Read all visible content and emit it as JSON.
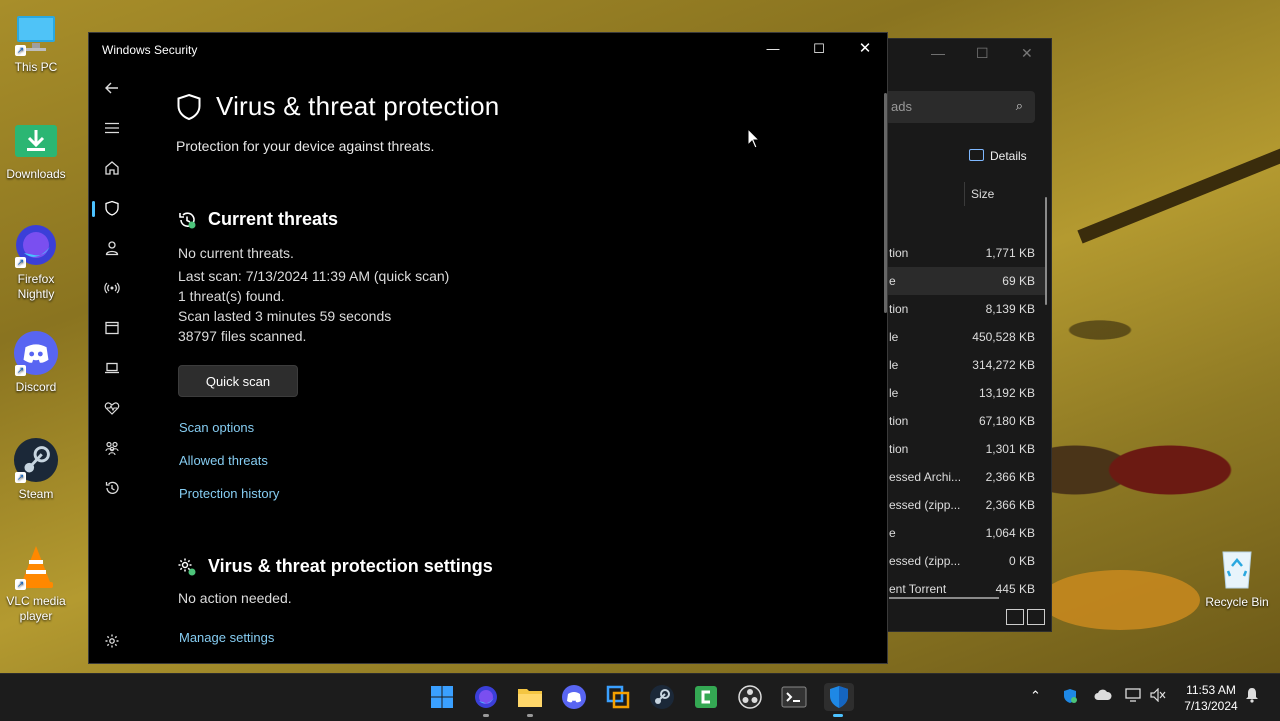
{
  "desktop": {
    "icons": [
      {
        "label": "This PC"
      },
      {
        "label": "Downloads"
      },
      {
        "label": "Firefox Nightly"
      },
      {
        "label": "Discord"
      },
      {
        "label": "Steam"
      },
      {
        "label": "VLC media player"
      },
      {
        "label": "Recycle Bin"
      }
    ]
  },
  "explorer": {
    "search_fragment": "ads",
    "details_label": "Details",
    "size_header": "Size",
    "rows": [
      {
        "type": "tion",
        "size": "1,771 KB"
      },
      {
        "type": "e",
        "size": "69 KB"
      },
      {
        "type": "tion",
        "size": "8,139 KB"
      },
      {
        "type": "le",
        "size": "450,528 KB"
      },
      {
        "type": "le",
        "size": "314,272 KB"
      },
      {
        "type": "le",
        "size": "13,192 KB"
      },
      {
        "type": "tion",
        "size": "67,180 KB"
      },
      {
        "type": "tion",
        "size": "1,301 KB"
      },
      {
        "type": "essed Archi...",
        "size": "2,366 KB"
      },
      {
        "type": "essed (zipp...",
        "size": "2,366 KB"
      },
      {
        "type": "e",
        "size": "1,064 KB"
      },
      {
        "type": "essed (zipp...",
        "size": "0 KB"
      },
      {
        "type": "ent Torrent",
        "size": "445 KB"
      }
    ]
  },
  "security": {
    "window_title": "Windows Security",
    "page_title": "Virus & threat protection",
    "subtitle": "Protection for your device against threats.",
    "current_threats": {
      "title": "Current threats",
      "status": "No current threats.",
      "last_scan": "Last scan: 7/13/2024 11:39 AM (quick scan)",
      "threats_found": "1 threat(s) found.",
      "duration": "Scan lasted 3 minutes 59 seconds",
      "files_scanned": "38797 files scanned.",
      "quick_scan_label": "Quick scan",
      "links": {
        "scan_options": "Scan options",
        "allowed_threats": "Allowed threats",
        "protection_history": "Protection history"
      }
    },
    "settings": {
      "title": "Virus & threat protection settings",
      "status": "No action needed.",
      "manage_link": "Manage settings"
    },
    "accent_color": "#4cc2ff",
    "link_color": "#86cdf2"
  },
  "taskbar": {
    "time": "11:53 AM",
    "date": "7/13/2024"
  }
}
